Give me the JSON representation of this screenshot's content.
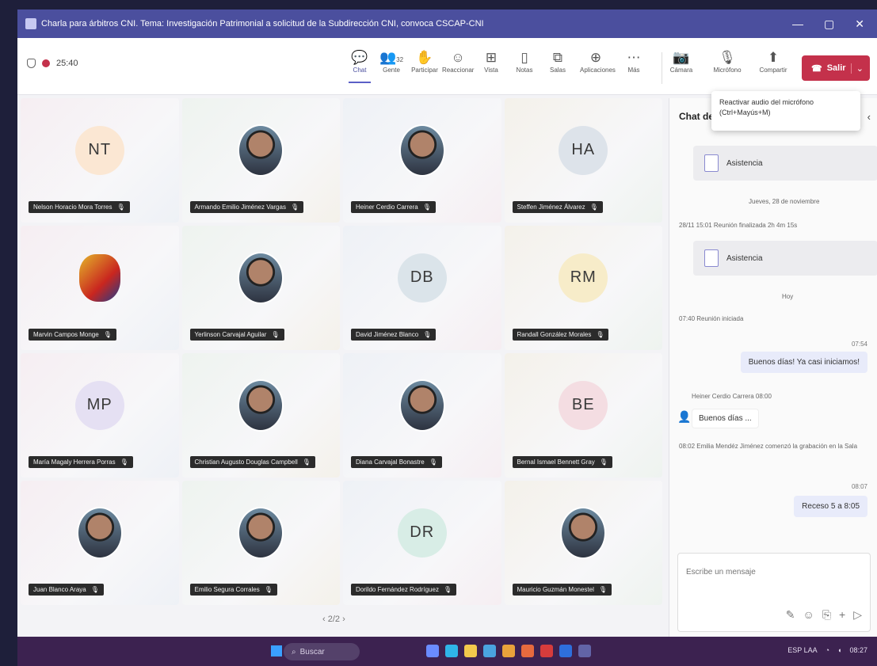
{
  "window": {
    "title": "Charla para árbitros CNI. Tema: Investigación Patrimonial a solicitud de la Subdirección CNI, convoca CSCAP-CNI",
    "controls": [
      "—",
      "▢",
      "✕"
    ]
  },
  "toolbar": {
    "timer": "25:40",
    "buttons": [
      {
        "label": "Chat",
        "glyph": "💬",
        "icon": "chat-icon"
      },
      {
        "label": "Gente",
        "glyph": "👥",
        "icon": "people-icon",
        "count": "32"
      },
      {
        "label": "Participar",
        "glyph": "✋",
        "icon": "raise-hand-icon"
      },
      {
        "label": "Reaccionar",
        "glyph": "☺",
        "icon": "react-icon"
      },
      {
        "label": "Vista",
        "glyph": "⊞",
        "icon": "view-icon"
      },
      {
        "label": "Notas",
        "glyph": "▯",
        "icon": "notes-icon"
      },
      {
        "label": "Salas",
        "glyph": "⧉",
        "icon": "rooms-icon"
      },
      {
        "label": "Aplicaciones",
        "glyph": "⊕",
        "icon": "apps-icon"
      },
      {
        "label": "Más",
        "glyph": "⋯",
        "icon": "more-icon"
      }
    ],
    "media": [
      {
        "label": "Cámara",
        "glyph": "📷",
        "icon": "camera-icon"
      },
      {
        "label": "Micrófono",
        "glyph": "🎙",
        "icon": "microphone-icon"
      },
      {
        "label": "Compartir",
        "glyph": "⬆",
        "icon": "share-icon"
      }
    ],
    "leave_label": "Salir"
  },
  "tooltip": {
    "line1": "Reactivar audio del micrófono",
    "line2": "(Ctrl+Mayús+M)"
  },
  "participants": [
    {
      "name": "Nelson Horacio Mora Torres",
      "initials": "NT",
      "kind": "initials",
      "bg": "#fbe7d3"
    },
    {
      "name": "Armando Emilio Jiménez Vargas",
      "kind": "photo"
    },
    {
      "name": "Heiner Cerdio Carrera",
      "kind": "photo"
    },
    {
      "name": "Steffen Jiménez Álvarez",
      "initials": "HA",
      "kind": "initials",
      "bg": "#dde3ea"
    },
    {
      "name": "Marvin Campos Monge",
      "kind": "logo"
    },
    {
      "name": "Yerlinson Carvajal Aguilar",
      "kind": "photo"
    },
    {
      "name": "David Jiménez Blanco",
      "initials": "DB",
      "kind": "initials",
      "bg": "#dbe4ea"
    },
    {
      "name": "Randall González Morales",
      "initials": "RM",
      "kind": "initials",
      "bg": "#f7ecc9"
    },
    {
      "name": "María Magaly Herrera Porras",
      "initials": "MP",
      "kind": "initials",
      "bg": "#e5e0f3"
    },
    {
      "name": "Christian Augusto Douglas Campbell",
      "kind": "photo"
    },
    {
      "name": "Diana Carvajal Bonastre",
      "kind": "photo"
    },
    {
      "name": "Bernal Ismael Bennett Gray",
      "initials": "BE",
      "kind": "initials",
      "bg": "#f4dde2"
    },
    {
      "name": "Juan Blanco Araya",
      "kind": "photo"
    },
    {
      "name": "Emilio Segura Corrales",
      "kind": "photo"
    },
    {
      "name": "Dorildo Fernández Rodríguez",
      "initials": "DR",
      "kind": "initials",
      "bg": "#d8ede6"
    },
    {
      "name": "Mauricio Guzmán Monestel",
      "kind": "photo"
    }
  ],
  "pager": "‹  2/2  ›",
  "chat": {
    "title": "Chat de",
    "card1": "Asistencia",
    "date1": "Jueves, 28 de noviembre",
    "sys1": "28/11 15:01   Reunión finalizada 2h 4m 15s",
    "card2": "Asistencia",
    "date2": "Hoy",
    "sys2": "07:40   Reunión iniciada",
    "time1": "07:54",
    "msg1": "Buenos días! Ya casi iniciamos!",
    "sender2": "Heiner Cerdio Carrera  08:00",
    "msg2": "Buenos días ...",
    "sys3": "08:02   Emilia Mendéz Jiménez comenzó la grabación en la Sala",
    "time2": "08:07",
    "msg3": "Receso 5 a 8:05",
    "composer_placeholder": "Escribe un mensaje"
  },
  "taskbar": {
    "search_label": "Buscar",
    "tray_time": "08:27",
    "tray_lang": "ESP LAA"
  }
}
